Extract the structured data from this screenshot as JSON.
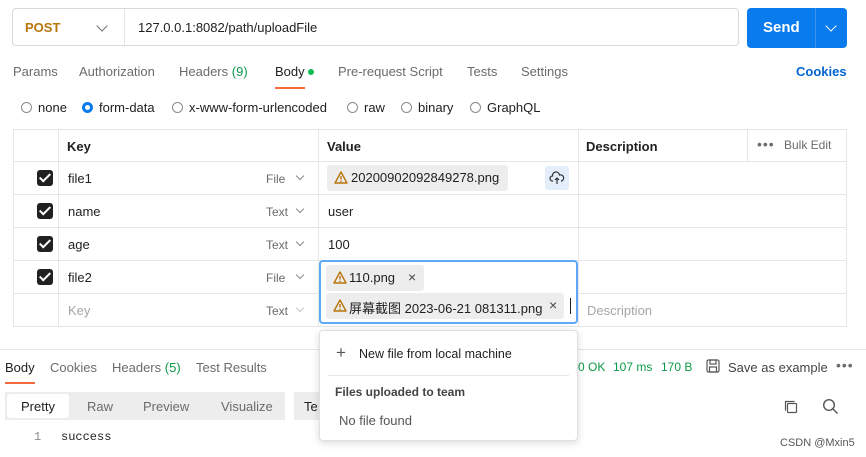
{
  "request": {
    "method": "POST",
    "url": "127.0.0.1:8082/path/uploadFile",
    "send_label": "Send"
  },
  "tabs": [
    {
      "label": "Params"
    },
    {
      "label": "Authorization"
    },
    {
      "label": "Headers",
      "count": "(9)"
    },
    {
      "label": "Body"
    },
    {
      "label": "Pre-request Script"
    },
    {
      "label": "Tests"
    },
    {
      "label": "Settings"
    }
  ],
  "cookies_label": "Cookies",
  "body_types": [
    "none",
    "form-data",
    "x-www-form-urlencoded",
    "raw",
    "binary",
    "GraphQL"
  ],
  "body_type_selected": "form-data",
  "table": {
    "headers": {
      "key": "Key",
      "value": "Value",
      "description": "Description",
      "bulk_edit": "Bulk Edit"
    },
    "rows": [
      {
        "checked": true,
        "key": "file1",
        "type": "File",
        "value": "20200902092849278.png"
      },
      {
        "checked": true,
        "key": "name",
        "type": "Text",
        "value": "user"
      },
      {
        "checked": true,
        "key": "age",
        "type": "Text",
        "value": "100"
      },
      {
        "checked": true,
        "key": "file2",
        "type": "File",
        "value_files": [
          "110.png",
          "屏幕截图 2023-06-21 081311.png"
        ]
      }
    ],
    "new_row": {
      "key_placeholder": "Key",
      "type": "Text",
      "description_placeholder": "Description"
    }
  },
  "file_dropdown": {
    "new_file": "New file from local machine",
    "section": "Files uploaded to team",
    "empty": "No file found"
  },
  "response": {
    "tabs": [
      {
        "label": "Body"
      },
      {
        "label": "Cookies"
      },
      {
        "label": "Headers",
        "count": "(5)"
      },
      {
        "label": "Test Results"
      }
    ],
    "status": "0 OK",
    "time": "107 ms",
    "size": "170 B",
    "save_example": "Save as example",
    "view_modes": [
      "Pretty",
      "Raw",
      "Preview",
      "Visualize"
    ],
    "format_partial": "Te",
    "line_no": "1",
    "body_text": "success"
  },
  "watermark": "CSDN @Mxin5",
  "colors": {
    "accent": "#097bed",
    "method": "#b8750a",
    "ok": "#0c9a47",
    "body_dot": "#0cbb52"
  }
}
